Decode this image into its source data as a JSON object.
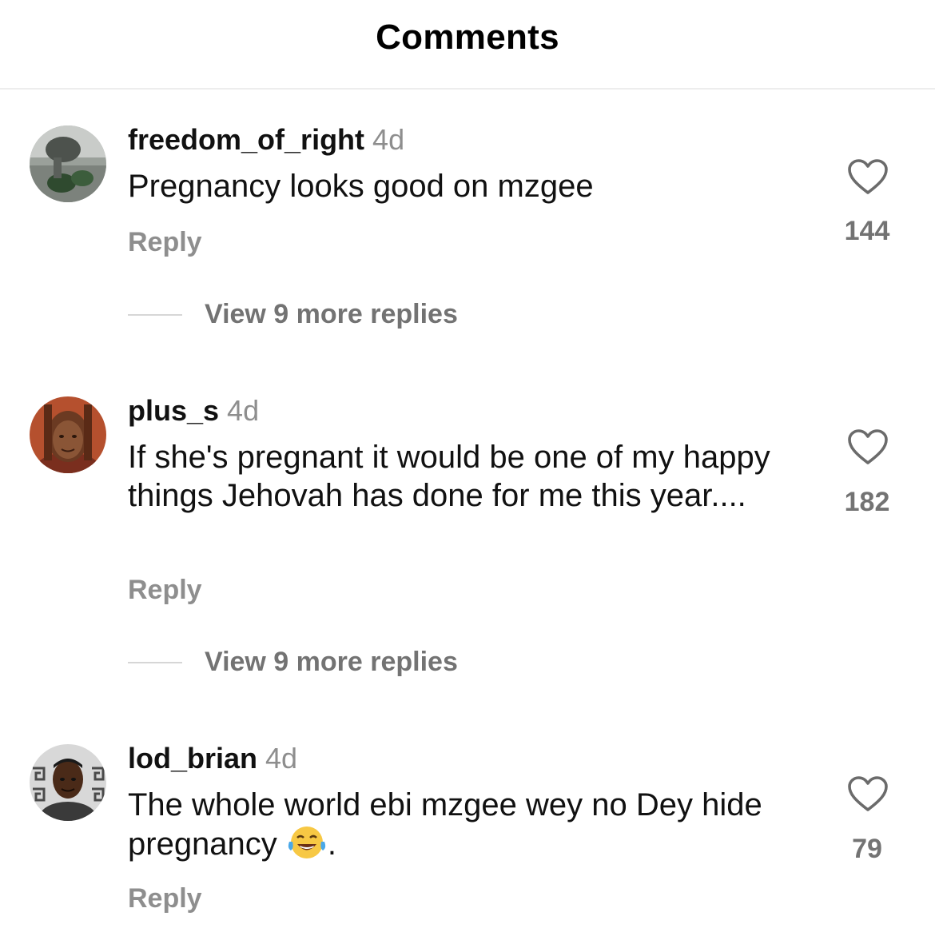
{
  "header": {
    "title": "Comments"
  },
  "comments": [
    {
      "username": "freedom_of_right",
      "time": "4d",
      "text": "Pregnancy looks good on mzgee",
      "reply_label": "Reply",
      "likes": "144",
      "view_more": "View 9 more replies"
    },
    {
      "username": "plus_s",
      "time": "4d",
      "text": "If she's pregnant it would be one of my happy things Jehovah has done for me this year....",
      "reply_label": "Reply",
      "likes": "182",
      "view_more": "View 9 more replies"
    },
    {
      "username": "lod_brian",
      "time": "4d",
      "text": "The whole world ebi mzgee wey no Dey hide pregnancy",
      "text_suffix": ".",
      "reply_label": "Reply",
      "likes": "79"
    }
  ],
  "icons": {
    "like": "heart-outline-icon",
    "emoji": "tears-of-joy-emoji"
  }
}
